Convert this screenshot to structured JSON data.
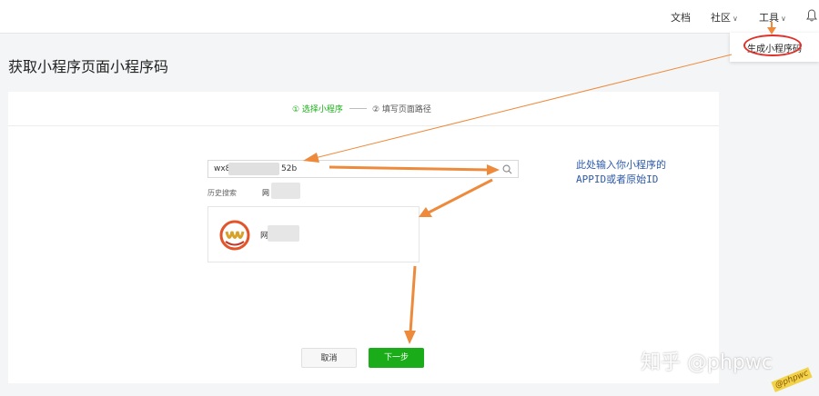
{
  "nav": {
    "docs": "文档",
    "community": "社区",
    "tools": "工具"
  },
  "tools_menu": {
    "item": "生成小程序码"
  },
  "page": {
    "title": "获取小程序页面小程序码"
  },
  "steps": [
    {
      "label": "① 选择小程序",
      "state": "active"
    },
    {
      "label": "② 填写页面路径",
      "state": "inactive"
    }
  ],
  "search": {
    "value_start": "wx8",
    "value_end": "52b"
  },
  "history": {
    "label": "历史搜索",
    "item": "网"
  },
  "result": {
    "name": "网"
  },
  "buttons": {
    "cancel": "取消",
    "next": "下一步"
  },
  "annotation": {
    "line1": "此处输入你小程序的",
    "line2": "APPID或者原始ID"
  },
  "watermark": {
    "text": "知乎 @phpwc"
  },
  "stamp": {
    "text": "@phpwc"
  },
  "colors": {
    "accent": "#1aad19",
    "arrow": "#ee8a3c",
    "highlight": "#e0302a",
    "annotation": "#2d5aa8"
  },
  "icons": [
    "chevron-down-icon",
    "bell-icon",
    "search-icon",
    "app-logo"
  ]
}
